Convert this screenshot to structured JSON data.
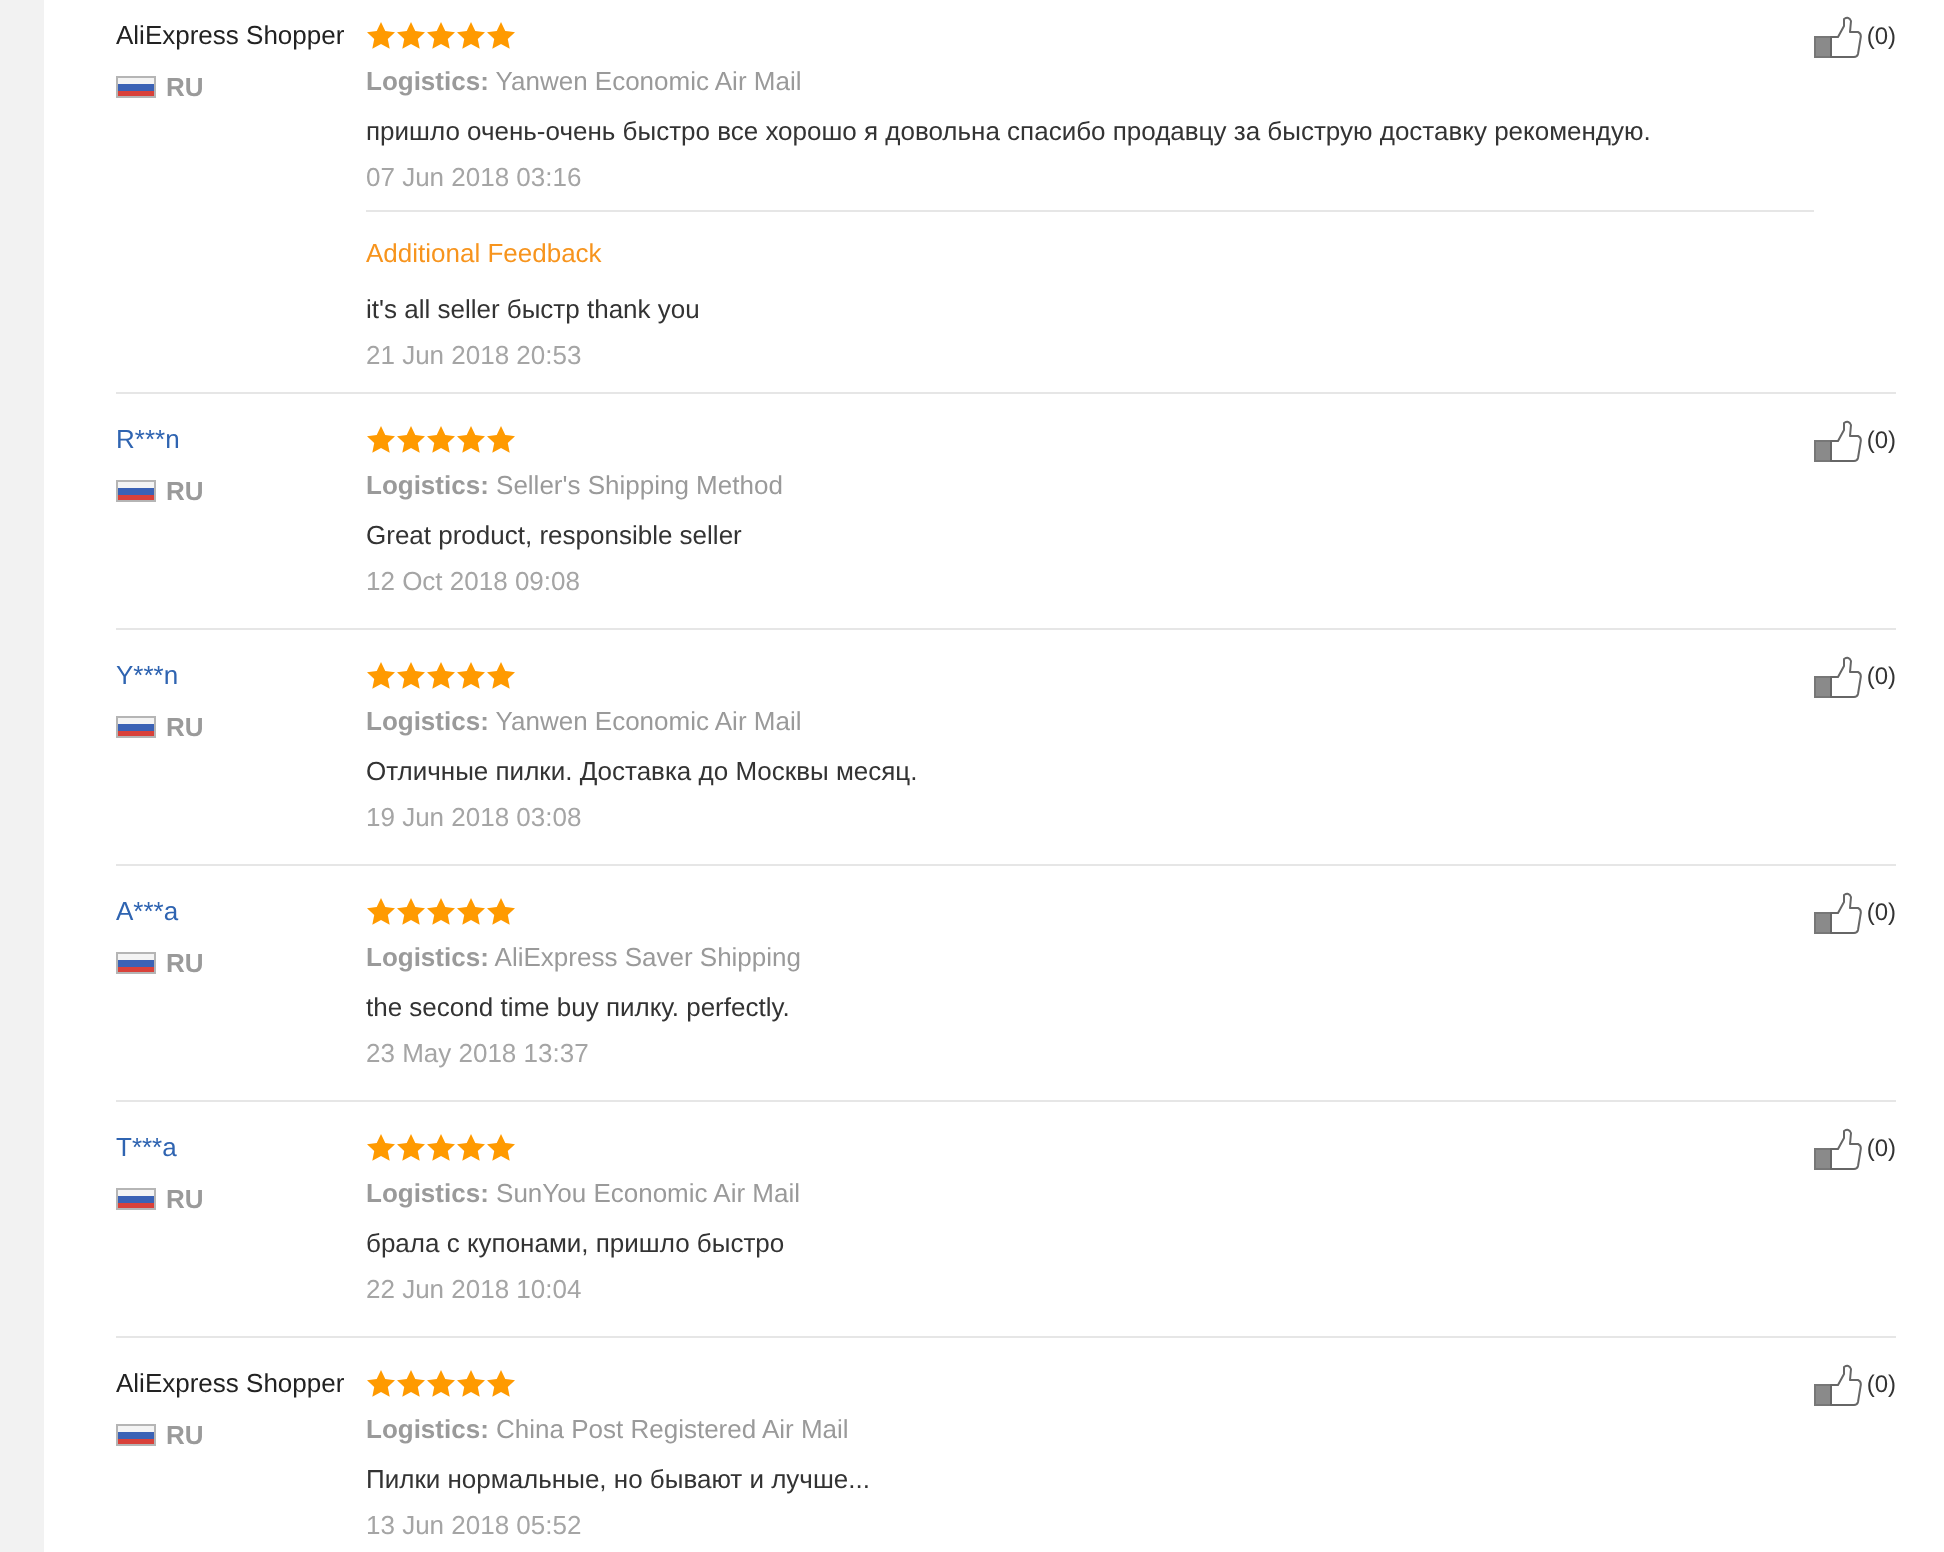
{
  "reviews": [
    {
      "user": "AliExpress Shopper",
      "linked": false,
      "country": "RU",
      "stars": 5,
      "logistics": "**Logistics:** Yanwen Economic Air Mail",
      "text": "пришло очень-очень быстро все хорошо я довольна спасибо продавцу за быструю доставку рекомендую.",
      "date": "07 Jun 2018 03:16",
      "likes": "(0)",
      "additional_feedback": {
        "heading": "Additional Feedback",
        "text": "it's all seller быстр thank you",
        "date": "21 Jun 2018 20:53"
      }
    },
    {
      "user": "R***n",
      "linked": true,
      "country": "RU",
      "stars": 5,
      "logistics": "**Logistics:** Seller's Shipping Method",
      "text": "Great product, responsible seller",
      "date": "12 Oct 2018 09:08",
      "likes": "(0)"
    },
    {
      "user": "Y***n",
      "linked": true,
      "country": "RU",
      "stars": 5,
      "logistics": "**Logistics:** Yanwen Economic Air Mail",
      "text": "Отличные пилки. Доставка до Москвы месяц.",
      "date": "19 Jun 2018 03:08",
      "likes": "(0)"
    },
    {
      "user": "A***a",
      "linked": true,
      "country": "RU",
      "stars": 5,
      "logistics": "**Logistics:** AliExpress Saver Shipping",
      "text": "the second time buy пилку. perfectly.",
      "date": "23 May 2018 13:37",
      "likes": "(0)"
    },
    {
      "user": "T***a",
      "linked": true,
      "country": "RU",
      "stars": 5,
      "logistics": "**Logistics:** SunYou Economic Air Mail",
      "text": "брала с купонами, пришло быстро",
      "date": "22 Jun 2018 10:04",
      "likes": "(0)"
    },
    {
      "user": "AliExpress Shopper",
      "linked": false,
      "country": "RU",
      "stars": 5,
      "logistics": "**Logistics:** China Post Registered Air Mail",
      "text": "Пилки нормальные, но бывают и лучше...",
      "date": "13 Jun 2018 05:52",
      "likes": "(0)"
    }
  ]
}
